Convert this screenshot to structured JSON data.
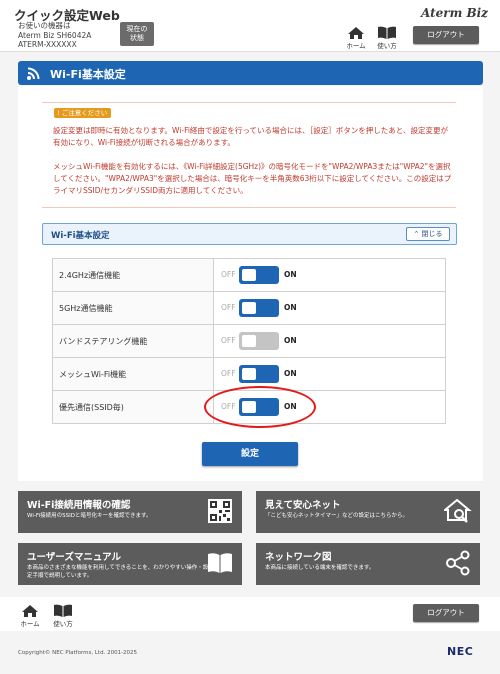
{
  "header": {
    "app_title": "クイック設定Web",
    "device_label": "お使いの機器は",
    "device_model": "Aterm Biz SH6042A",
    "device_id": "ATERM-XXXXXX",
    "status_line1": "現在の",
    "status_line2": "状態",
    "brand": "Aterm Biz",
    "home_label": "ホーム",
    "help_label": "使い方",
    "logout_label": "ログアウト"
  },
  "page": {
    "title": "Wi-Fi基本設定"
  },
  "notice": {
    "badge": "ご注意ください",
    "paragraph1": "設定変更は即時に有効となります。Wi-Fi経由で設定を行っている場合には、［設定］ボタンを押したあと、設定変更が有効になり、Wi-Fi接続が切断される場合があります。",
    "paragraph2": "メッシュWi-Fi機能を有効化するには、《Wi-Fi詳細設定(5GHz)》の暗号化モードを\"WPA2/WPA3または\"WPA2\"を選択してください。\"WPA2/WPA3\"を選択した場合は、暗号化キーを半角英数63桁以下に設定してください。この設定はプライマリSSID/セカンダリSSID両方に適用してください。"
  },
  "section": {
    "title": "Wi-Fi基本設定",
    "collapse_label": "閉じる",
    "off_label": "OFF",
    "on_label": "ON",
    "rows": [
      {
        "label": "2.4GHz通信機能",
        "enabled": true,
        "disabled": false
      },
      {
        "label": "5GHz通信機能",
        "enabled": true,
        "disabled": false
      },
      {
        "label": "バンドステアリング機能",
        "enabled": true,
        "disabled": true
      },
      {
        "label": "メッシュWi-Fi機能",
        "enabled": true,
        "disabled": false
      },
      {
        "label": "優先通信(SSID毎)",
        "enabled": true,
        "disabled": false
      }
    ]
  },
  "submit_label": "設定",
  "tiles": [
    {
      "title": "Wi-Fi接続用情報の確認",
      "desc": "Wi-Fi接続用のSSIDと暗号化キーを確認できます。",
      "icon": "qr-code-icon"
    },
    {
      "title": "見えて安心ネット",
      "desc": "「こども安心ネットタイマー」などの設定はこちらから。",
      "icon": "home-search-icon"
    },
    {
      "title": "ユーザーズマニュアル",
      "desc": "本商品のさまざまな機能を利用してできることを、わかりやすい操作・設定手順で説明しています。",
      "icon": "book-icon"
    },
    {
      "title": "ネットワーク図",
      "desc": "本商品に接続している端末を確認できます。",
      "icon": "network-icon"
    }
  ],
  "footer": {
    "home_label": "ホーム",
    "help_label": "使い方",
    "logout_label": "ログアウト",
    "copyright": "Copyright© NEC Platforms, Ltd. 2001-2025",
    "nec": "NEC"
  },
  "colors": {
    "primary": "#1e66b4",
    "warning": "#c0392b",
    "tile": "#5c5c5c",
    "highlight": "#e41a1a"
  }
}
